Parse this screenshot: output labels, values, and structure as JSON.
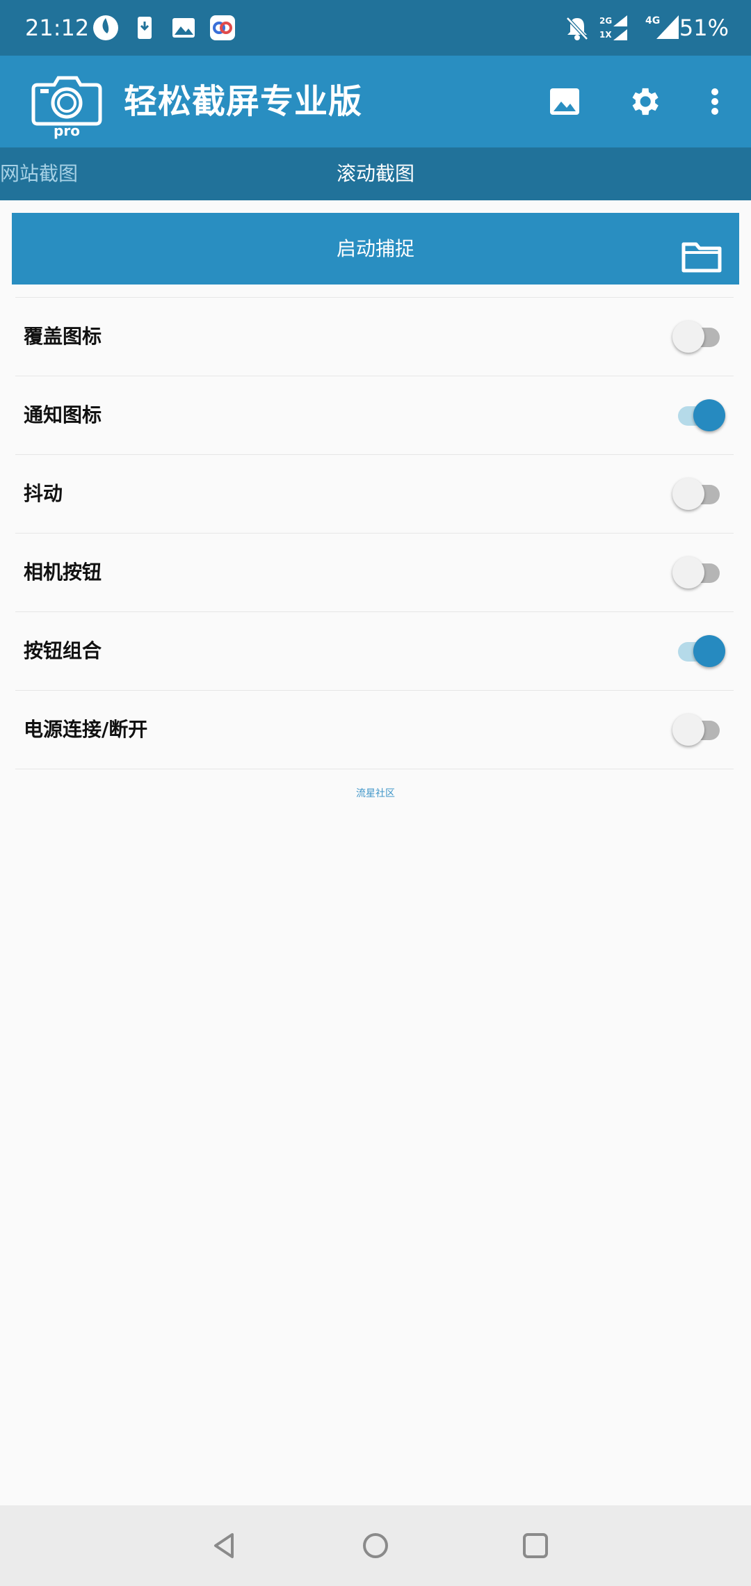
{
  "status_bar": {
    "time": "21:12",
    "battery": "51%",
    "icons": [
      "app-icon",
      "download-icon",
      "image-icon",
      "app-icon-2",
      "bell-off-icon",
      "signal-2g-icon",
      "signal-4g-icon"
    ]
  },
  "app_bar": {
    "title": "轻松截屏专业版",
    "logo_text": "pro",
    "actions": [
      "gallery-icon",
      "settings-icon",
      "more-vert-icon"
    ]
  },
  "tabs": [
    {
      "label": "网站截图",
      "active": false
    },
    {
      "label": "滚动截图",
      "active": true
    }
  ],
  "capture_button": {
    "label": "启动捕捉"
  },
  "settings": [
    {
      "label": "覆盖图标",
      "on": false
    },
    {
      "label": "通知图标",
      "on": true
    },
    {
      "label": "抖动",
      "on": false
    },
    {
      "label": "相机按钮",
      "on": false
    },
    {
      "label": "按钮组合",
      "on": true
    },
    {
      "label": "电源连接/断开",
      "on": false
    }
  ],
  "footer": {
    "link": "流星社区"
  },
  "colors": {
    "status_bar": "#21729a",
    "app_bar": "#298ec1",
    "accent": "#268ac0"
  }
}
